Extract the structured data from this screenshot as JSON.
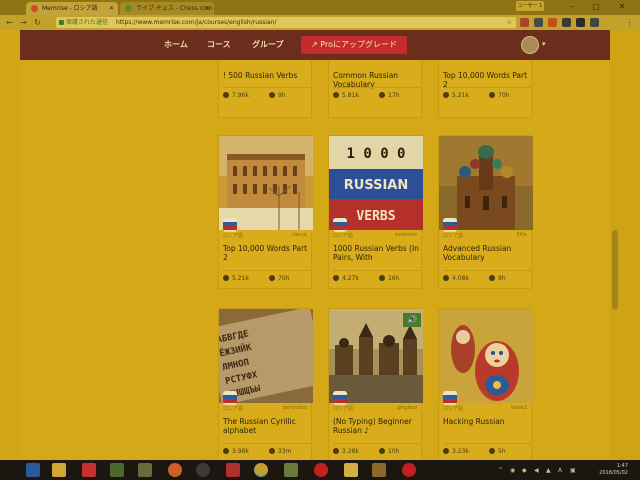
{
  "browser": {
    "tabs": [
      {
        "label": "Memrise - ロシア語"
      },
      {
        "label": "ライブ チェス - Chess.com"
      }
    ],
    "user_chip": "ユーザー 1",
    "secure_label": "保護された通信",
    "url": "https://www.memrise.com/ja/courses/english/russian/"
  },
  "site_nav": {
    "home": "ホーム",
    "courses": "コース",
    "groups": "グループ",
    "pro_button": "Proにアップグレード"
  },
  "cards_top": [
    {
      "title": "! 500 Russian Verbs",
      "learners": "7.96k",
      "time": "9h"
    },
    {
      "title": "Common Russian Vocabulary",
      "learners": "5.81k",
      "time": "17h"
    },
    {
      "title": "Top 10,000 Words Part 2",
      "learners": "5.21k",
      "time": "70h"
    }
  ],
  "cards_middle": [
    {
      "lang": "ロシア語",
      "author": "vlerye",
      "title": "Top 10,000 Words Part 2",
      "learners": "5.21k",
      "time": "70h"
    },
    {
      "lang": "ロシア語",
      "author": "sodevelo",
      "title": "1000 Russian Verbs (In Pairs, With",
      "learners": "4.27k",
      "time": "16h"
    },
    {
      "lang": "ロシア語",
      "author": "Ellie",
      "title": "Advanced Russian Vocabulary",
      "learners": "4.08k",
      "time": "9h"
    }
  ],
  "verbs_cover": {
    "line1": "1 0 0 0",
    "line2": "RUSSIAN",
    "line3": "VERBS"
  },
  "cards_bottom": [
    {
      "lang": "ロシア語",
      "author": "berlyokko",
      "title": "The Russian Cyrillic alphabet",
      "learners": "3.98k",
      "time": "33m"
    },
    {
      "lang": "ロシア語",
      "author": "gingbod",
      "title": "(No Typing) Beginner Russian ♪",
      "learners": "3.28k",
      "time": "10h"
    },
    {
      "lang": "ロシア語",
      "author": "lolole2",
      "title": "Hacking Russian",
      "learners": "3.23k",
      "time": "5h"
    }
  ],
  "cyrillic_letters": "АБВГДЕ ЁЖЗИЙК ЛМНОП РСТУФХ ЦЧШЩЪЫ ЬЭЮЯ",
  "taskbar": {
    "time": "1:47",
    "date": "2018/05/02"
  },
  "colors": {
    "nav_bg": "#6b2e1c",
    "pro_button": "#c42c2c",
    "page_bg": "#d5a817"
  }
}
